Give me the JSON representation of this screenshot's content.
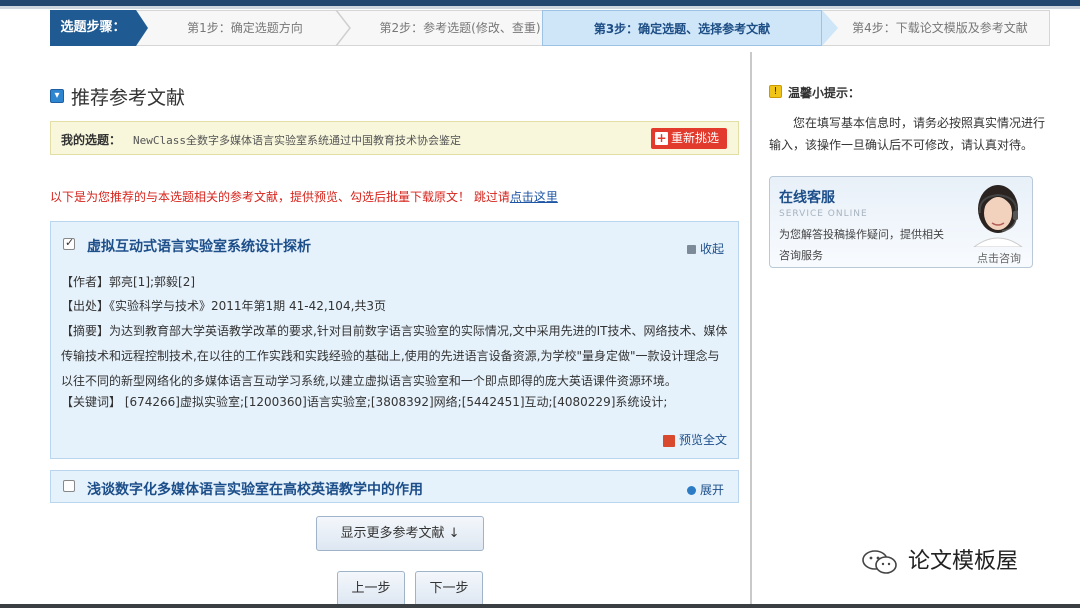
{
  "steps": {
    "label": "选题步骤：",
    "step1": "第1步：确定选题方向",
    "step2": "第2步：参考选题(修改、查重)",
    "step3": "第3步：确定选题、选择参考文献",
    "step4": "第4步：下载论文模版及参考文献"
  },
  "section": {
    "title": "推荐参考文献"
  },
  "topic": {
    "label": "我的选题：",
    "text": "NewClass全数字多媒体语言实验室系统通过中国教育技术协会鉴定",
    "reselect": "重新挑选"
  },
  "notice": {
    "text": "以下是为您推荐的与本选题相关的参考文献，提供预览、勾选后批量下载原文！",
    "skip": "跳过请",
    "link": "点击这里"
  },
  "paper1": {
    "checked": true,
    "title": "虚拟互动式语言实验室系统设计探析",
    "collapse": "收起",
    "author": "【作者】郭亮[1];郭毅[2]",
    "source": "【出处】《实验科学与技术》2011年第1期 41-42,104,共3页",
    "abstract": "【摘要】为达到教育部大学英语教学改革的要求,针对目前数字语言实验室的实际情况,文中采用先进的IT技术、网络技术、媒体传输技术和远程控制技术,在以往的工作实践和实践经验的基础上,使用的先进语言设备资源,为学校\"量身定做\"一款设计理念与以往不同的新型网络化的多媒体语言互动学习系统,以建立虚拟语言实验室和一个即点即得的庞大英语课件资源环境。",
    "keywords": "【关键词】 [674266]虚拟实验室;[1200360]语言实验室;[3808392]网络;[5442451]互动;[4080229]系统设计;",
    "preview": "预览全文"
  },
  "paper2": {
    "checked": false,
    "title": "浅谈数字化多媒体语言实验室在高校英语教学中的作用",
    "expand": "展开"
  },
  "buttons": {
    "more": "显示更多参考文献 ↓",
    "prev": "上一步",
    "next": "下一步"
  },
  "tips": {
    "title": "温馨小提示：",
    "text": "您在填写基本信息时，请务必按照真实情况进行输入，该操作一旦确认后不可修改，请认真对待。"
  },
  "service": {
    "title": "在线客服",
    "subtitle": "SERVICE ONLINE",
    "text": "为您解答投稿操作疑问，提供相关咨询服务",
    "link": "点击咨询"
  },
  "watermark": {
    "text": "论文模板屋"
  },
  "colors": {
    "accent": "#1f5a92",
    "active_step": "#cfe6f8",
    "notice_red": "#d6241c",
    "link_blue": "#1d56a5"
  }
}
